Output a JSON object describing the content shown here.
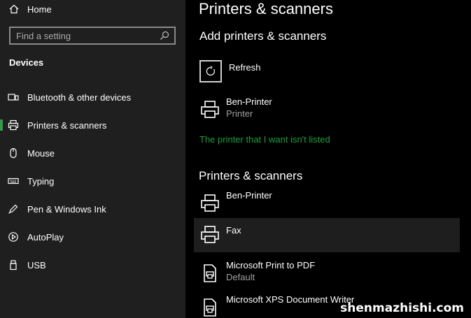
{
  "sidebar": {
    "home_label": "Home",
    "search_placeholder": "Find a setting",
    "section_title": "Devices",
    "items": [
      {
        "label": "Bluetooth & other devices",
        "icon": "bluetooth-devices-icon"
      },
      {
        "label": "Printers & scanners",
        "icon": "printer-icon",
        "selected": true
      },
      {
        "label": "Mouse",
        "icon": "mouse-icon"
      },
      {
        "label": "Typing",
        "icon": "keyboard-icon"
      },
      {
        "label": "Pen & Windows Ink",
        "icon": "pen-icon"
      },
      {
        "label": "AutoPlay",
        "icon": "autoplay-icon"
      },
      {
        "label": "USB",
        "icon": "usb-icon"
      }
    ]
  },
  "main": {
    "title": "Printers & scanners",
    "add_section_title": "Add printers & scanners",
    "refresh_label": "Refresh",
    "found_device": {
      "name": "Ben-Printer",
      "type": "Printer"
    },
    "not_listed_link": "The printer that I want isn't listed",
    "list_section_title": "Printers & scanners",
    "devices": [
      {
        "name": "Ben-Printer",
        "sub": ""
      },
      {
        "name": "Fax",
        "sub": ""
      },
      {
        "name": "Microsoft Print to PDF",
        "sub": "Default"
      },
      {
        "name": "Microsoft XPS Document Writer",
        "sub": ""
      }
    ]
  },
  "watermark": "shenmazhishi.com",
  "colors": {
    "accent": "#1e9e3a",
    "sidebar_bg": "#1f1f1f",
    "main_bg": "#000000",
    "hover_bg": "#1e1e1e"
  }
}
